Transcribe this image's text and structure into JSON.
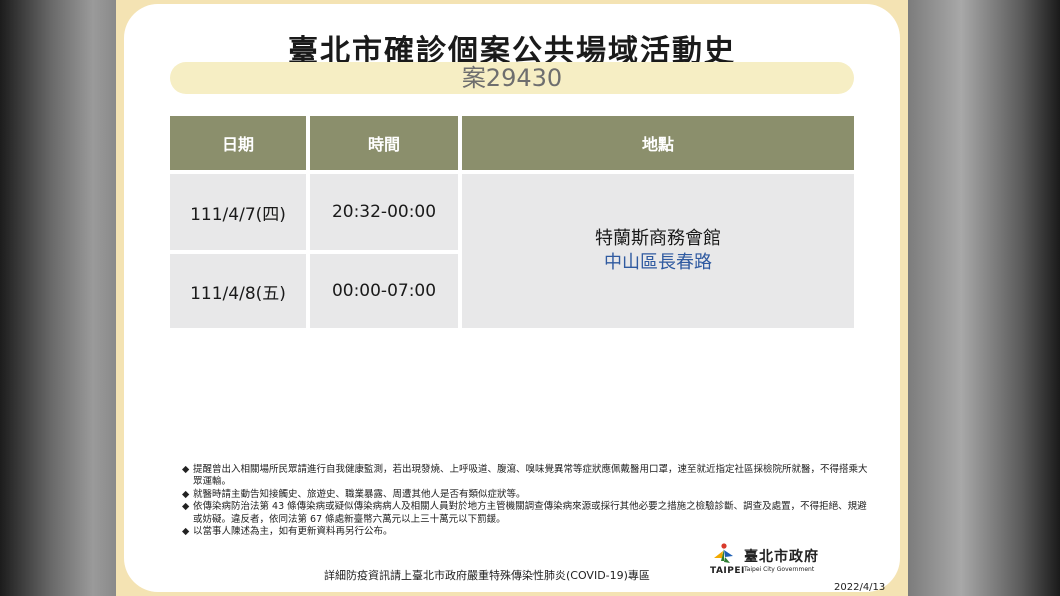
{
  "title": "臺北市確診個案公共場域活動史",
  "case_label": "案29430",
  "table": {
    "headers": [
      "日期",
      "時間",
      "地點"
    ],
    "rows": [
      {
        "date": "111/4/7(四)",
        "time": "20:32-00:00"
      },
      {
        "date": "111/4/8(五)",
        "time": "00:00-07:00"
      }
    ],
    "place_name": "特蘭斯商務會館",
    "place_district": "中山區長春路"
  },
  "notes": [
    "提醒曾出入相關場所民眾請進行自我健康監測，若出現發燒、上呼吸道、腹瀉、嗅味覺異常等症狀應佩戴醫用口罩，速至就近指定社區採檢院所就醫，不得搭乘大眾運輸。",
    "就醫時請主動告知接觸史、旅遊史、職業暴露、周遭其他人是否有類似症狀等。",
    "依傳染病防治法第 43 條傳染病或疑似傳染病病人及相關人員對於地方主管機關調查傳染病來源或採行其他必要之措施之檢驗診斷、調查及處置，不得拒絕、規避或妨礙。違反者，依同法第 67 條處新臺幣六萬元以上三十萬元以下罰鍰。",
    "以當事人陳述為主，如有更新資料再另行公布。"
  ],
  "bullet_symbol": "◆",
  "footer_text": "詳細防疫資訊請上臺北市政府嚴重特殊傳染性肺炎(COVID-19)專區",
  "logo": {
    "zh": "臺北市政府",
    "en": "TAIPEI",
    "sub": "Taipei City Government"
  },
  "date": "2022/4/13",
  "colors": {
    "frame": "#f4e3b3",
    "header_cell": "#8b8f6c",
    "body_cell": "#e8e8e9",
    "district_text": "#2f5aa0"
  }
}
